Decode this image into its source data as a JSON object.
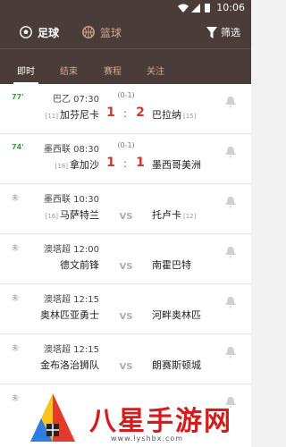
{
  "statusbar": {
    "time": "10:06",
    "icons": [
      "wifi-icon",
      "signal-icon",
      "battery-icon"
    ]
  },
  "header": {
    "sports": [
      {
        "label": "足球",
        "icon": "football-icon",
        "active": true
      },
      {
        "label": "篮球",
        "icon": "basketball-icon",
        "active": false
      }
    ],
    "filter": {
      "label": "筛选",
      "icon": "filter-icon"
    }
  },
  "tabs": [
    {
      "label": "即时",
      "active": true
    },
    {
      "label": "结束",
      "active": false
    },
    {
      "label": "赛程",
      "active": false
    },
    {
      "label": "关注",
      "active": false
    }
  ],
  "matches": [
    {
      "status": "77'",
      "live": true,
      "league_time": "巴乙 07:30",
      "half": "(0-1)",
      "home": "加芬尼卡",
      "home_rank": "[11]",
      "away": "巴拉纳",
      "away_rank": "[15]",
      "home_score": "1",
      "away_score": "2",
      "vs": ""
    },
    {
      "status": "74'",
      "live": true,
      "league_time": "墨西联 08:30",
      "half": "(0-1)",
      "home": "拿加沙",
      "home_rank": "[18]",
      "away": "墨西哥美洲",
      "away_rank": "",
      "home_score": "1",
      "away_score": "1",
      "vs": ""
    },
    {
      "status": "未",
      "live": false,
      "league_time": "墨西联 10:30",
      "half": "",
      "home": "马萨特兰",
      "home_rank": "[16]",
      "away": "托卢卡",
      "away_rank": "[12]",
      "home_score": "",
      "away_score": "",
      "vs": "VS"
    },
    {
      "status": "未",
      "live": false,
      "league_time": "澳塔超 12:00",
      "half": "",
      "home": "德文前锋",
      "home_rank": "",
      "away": "南霍巴特",
      "away_rank": "",
      "home_score": "",
      "away_score": "",
      "vs": "VS"
    },
    {
      "status": "未",
      "live": false,
      "league_time": "澳塔超 12:15",
      "half": "",
      "home": "奥林匹亚勇士",
      "home_rank": "",
      "away": "河畔奥林匹",
      "away_rank": "",
      "home_score": "",
      "away_score": "",
      "vs": "VS"
    },
    {
      "status": "未",
      "live": false,
      "league_time": "澳塔超 12:15",
      "half": "",
      "home": "金布洛治狮队",
      "home_rank": "",
      "away": "朗赛斯顿城",
      "away_rank": "",
      "home_score": "",
      "away_score": "",
      "vs": "VS"
    },
    {
      "status": "未",
      "live": false,
      "league_time": "",
      "half": "",
      "home": "",
      "home_rank": "",
      "away": "",
      "away_rank": "",
      "home_score": "",
      "away_score": "",
      "vs": ""
    }
  ],
  "watermark": {
    "text": "八星手游网",
    "url": "www.lyshbx.com",
    "icon": "watermark-logo-icon"
  },
  "colors": {
    "header_bg": "#4a3c38",
    "accent": "#d4a98d",
    "score_red": "#d9322b",
    "live_green": "#2fa53a"
  }
}
